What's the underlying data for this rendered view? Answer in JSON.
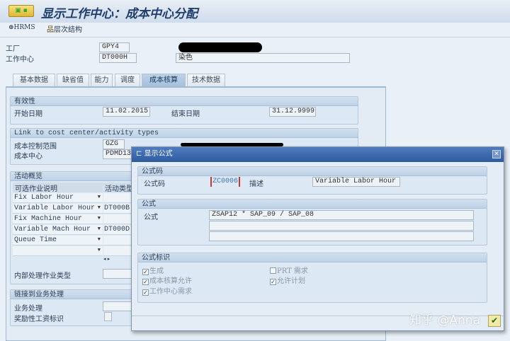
{
  "title": "显示工作中心：成本中心分配",
  "toolbar": {
    "hrms": "HRMS",
    "hierarchy": "层次结构"
  },
  "header": {
    "plant_label": "工厂",
    "plant": "GPY4",
    "wc_label": "工作中心",
    "wc": "DT000H",
    "wc_desc": "染色"
  },
  "tabs": [
    "基本数据",
    "缺省值",
    "能力",
    "调度",
    "成本核算",
    "技术数据"
  ],
  "validity": {
    "title": "有效性",
    "start_label": "开始日期",
    "start": "11.02.2015",
    "end_label": "结束日期",
    "end": "31.12.9999"
  },
  "link": {
    "title": "Link to cost center/activity types",
    "area_label": "成本控制范围",
    "area": "GZG",
    "cc_label": "成本中心",
    "cc": "PDMD13"
  },
  "activities": {
    "title": "活动概览",
    "col1": "可选作业说明",
    "col2": "活动类型",
    "rows": [
      {
        "desc": "Fix Labor Hour",
        "type": ""
      },
      {
        "desc": "Variable Labor Hour",
        "type": "DT000B"
      },
      {
        "desc": "Fix Machine Hour",
        "type": ""
      },
      {
        "desc": "Variable Mach Hour",
        "type": "DT000D"
      },
      {
        "desc": "Queue Time",
        "type": ""
      },
      {
        "desc": "",
        "type": ""
      }
    ],
    "internal_label": "内部处理作业类型"
  },
  "business": {
    "title": "链接到业务处理",
    "proc_label": "业务处理",
    "incentive_label": "奖励性工资标识"
  },
  "dialog": {
    "title": "显示公式",
    "code_group": "公式码",
    "code_label": "公式码",
    "code": "ZC0006",
    "desc_label": "描述",
    "desc": "Variable Labor Hour",
    "formula_group": "公式",
    "formula_label": "公式",
    "formula": "ZSAP12 * SAP_09 / SAP_08",
    "flags_group": "公式标识",
    "flags": [
      {
        "label": "生成",
        "checked": true
      },
      {
        "label": "PRT 需求",
        "checked": false
      },
      {
        "label": "成本核算允许",
        "checked": true
      },
      {
        "label": "允许计划",
        "checked": true
      },
      {
        "label": "工作中心需求",
        "checked": true
      }
    ]
  },
  "watermark": "知乎 @Anna"
}
